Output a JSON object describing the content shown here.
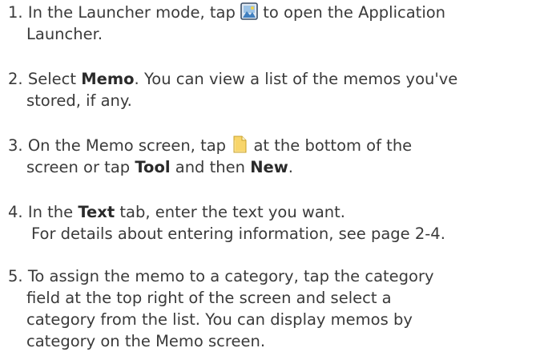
{
  "steps": [
    {
      "number": "1.",
      "line1_a": "In the Launcher mode, tap",
      "icon": "application-launcher-icon",
      "line1_b": "to open the Application",
      "line2": "Launcher."
    },
    {
      "number": "2.",
      "line1_a": "Select",
      "bold_1": "Memo",
      "line1_b": ". You can view a list of the memos you've",
      "line2": "stored, if any."
    },
    {
      "number": "3.",
      "line1_a": "On the Memo screen, tap",
      "icon": "new-memo-icon",
      "line1_b": "at the bottom of the",
      "line2_a": "screen or tap",
      "bold_1": "Tool",
      "line2_b": "and then",
      "bold_2": "New",
      "line2_c": "."
    },
    {
      "number": "4.",
      "line1_a": "In the",
      "bold_1": "Text",
      "line1_b": "tab, enter the text you want.",
      "line2": "For details about entering information, see page 2-4."
    },
    {
      "number": "5.",
      "line1": "To assign the memo to a category, tap the category",
      "line2": "field at the top right of the screen and select a",
      "line3": "category from the list. You can display memos by",
      "line4": "category on the Memo screen."
    }
  ]
}
